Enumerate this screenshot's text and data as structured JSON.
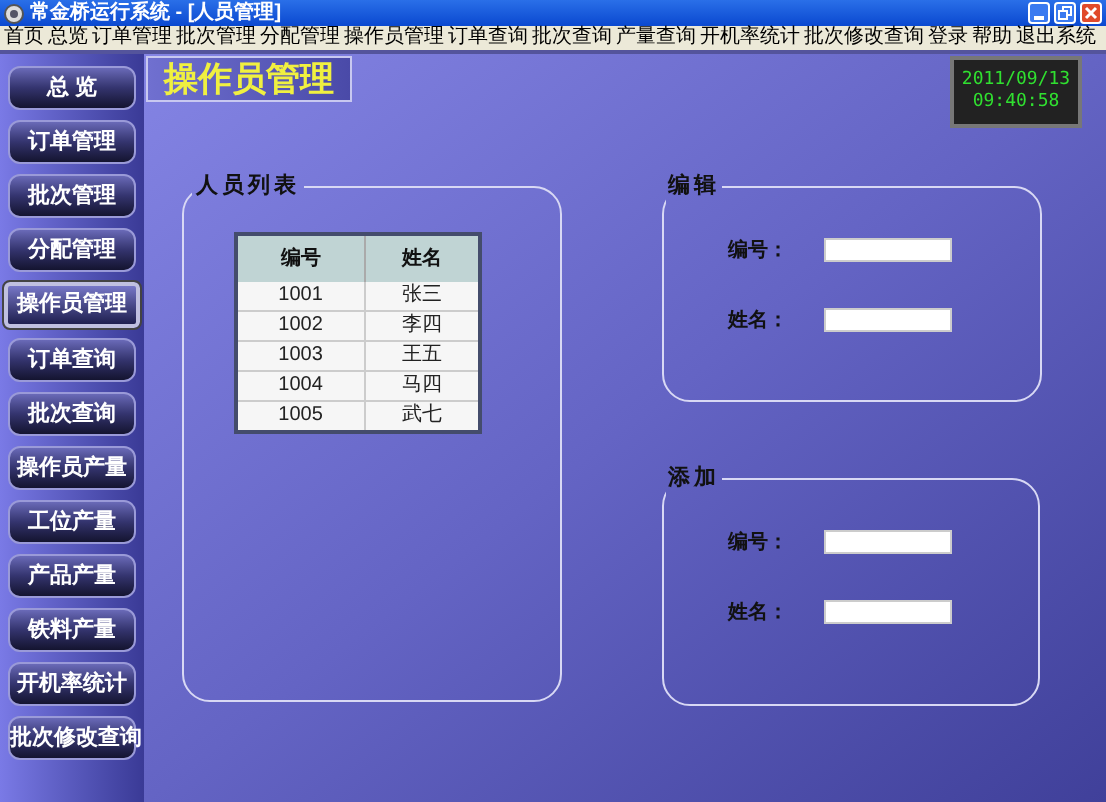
{
  "window": {
    "title": "常金桥运行系统 - [人员管理]"
  },
  "menu": [
    "首页",
    "总览",
    "订单管理",
    "批次管理",
    "分配管理",
    "操作员管理",
    "订单查询",
    "批次查询",
    "产量查询",
    "开机率统计",
    "批次修改查询",
    "登录",
    "帮助",
    "退出系统"
  ],
  "sidebar": [
    {
      "label": "总 览",
      "selected": false
    },
    {
      "label": "订单管理",
      "selected": false
    },
    {
      "label": "批次管理",
      "selected": false
    },
    {
      "label": "分配管理",
      "selected": false
    },
    {
      "label": "操作员管理",
      "selected": true
    },
    {
      "label": "订单查询",
      "selected": false
    },
    {
      "label": "批次查询",
      "selected": false
    },
    {
      "label": "操作员产量",
      "selected": false
    },
    {
      "label": "工位产量",
      "selected": false
    },
    {
      "label": "产品产量",
      "selected": false
    },
    {
      "label": "铁料产量",
      "selected": false
    },
    {
      "label": "开机率统计",
      "selected": false
    },
    {
      "label": "批次修改查询",
      "selected": false
    }
  ],
  "page_title": "操作员管理",
  "clock": {
    "date": "2011/09/13",
    "time": "09:40:58"
  },
  "staff_list": {
    "title": "人员列表",
    "columns": [
      "编号",
      "姓名"
    ],
    "rows": [
      [
        "1001",
        "张三"
      ],
      [
        "1002",
        "李四"
      ],
      [
        "1003",
        "王五"
      ],
      [
        "1004",
        "马四"
      ],
      [
        "1005",
        "武七"
      ]
    ]
  },
  "edit": {
    "title": "编辑",
    "fields": [
      {
        "label": "编号："
      },
      {
        "label": "姓名："
      }
    ]
  },
  "add": {
    "title": "添加",
    "fields": [
      {
        "label": "编号："
      },
      {
        "label": "姓名："
      }
    ]
  }
}
